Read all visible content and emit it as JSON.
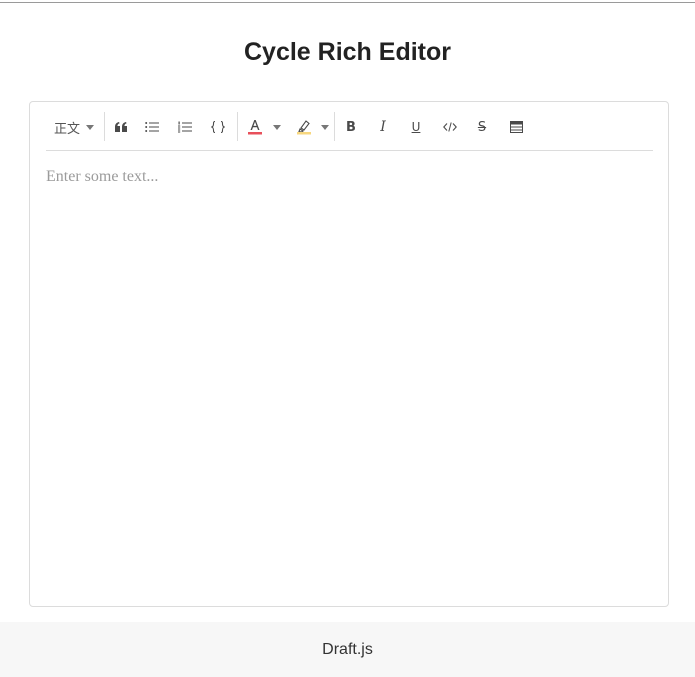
{
  "page": {
    "title": "Cycle Rich Editor"
  },
  "toolbar": {
    "block_type": {
      "value": "正文"
    },
    "buttons": [
      {
        "name": "blockquote",
        "icon": "quote-icon"
      },
      {
        "name": "unordered-list",
        "icon": "bulleted-list-icon"
      },
      {
        "name": "ordered-list",
        "icon": "numbered-list-icon"
      },
      {
        "name": "code-block",
        "icon": "code-braces-icon"
      },
      {
        "name": "font-color",
        "icon": "text-color-icon",
        "color": "#e8505b"
      },
      {
        "name": "highlight",
        "icon": "highlighter-icon",
        "color": "#f7d77f"
      },
      {
        "name": "bold",
        "icon": "bold-icon",
        "label": "B"
      },
      {
        "name": "italic",
        "icon": "italic-icon",
        "label": "I"
      },
      {
        "name": "underline",
        "icon": "underline-icon",
        "label": "U"
      },
      {
        "name": "inline-code",
        "icon": "inline-code-icon"
      },
      {
        "name": "strikethrough",
        "icon": "strikethrough-icon",
        "label": "S"
      },
      {
        "name": "table",
        "icon": "table-icon"
      }
    ]
  },
  "editor": {
    "placeholder": "Enter some text..."
  },
  "footer": {
    "link_text": "Draft.js"
  },
  "colors": {
    "border": "#dcdcdc",
    "footer_bg": "#f7f7f7",
    "placeholder": "#9b9b9b",
    "text_color_bar": "#e8505b",
    "highlight_bar": "#f7d77f"
  }
}
